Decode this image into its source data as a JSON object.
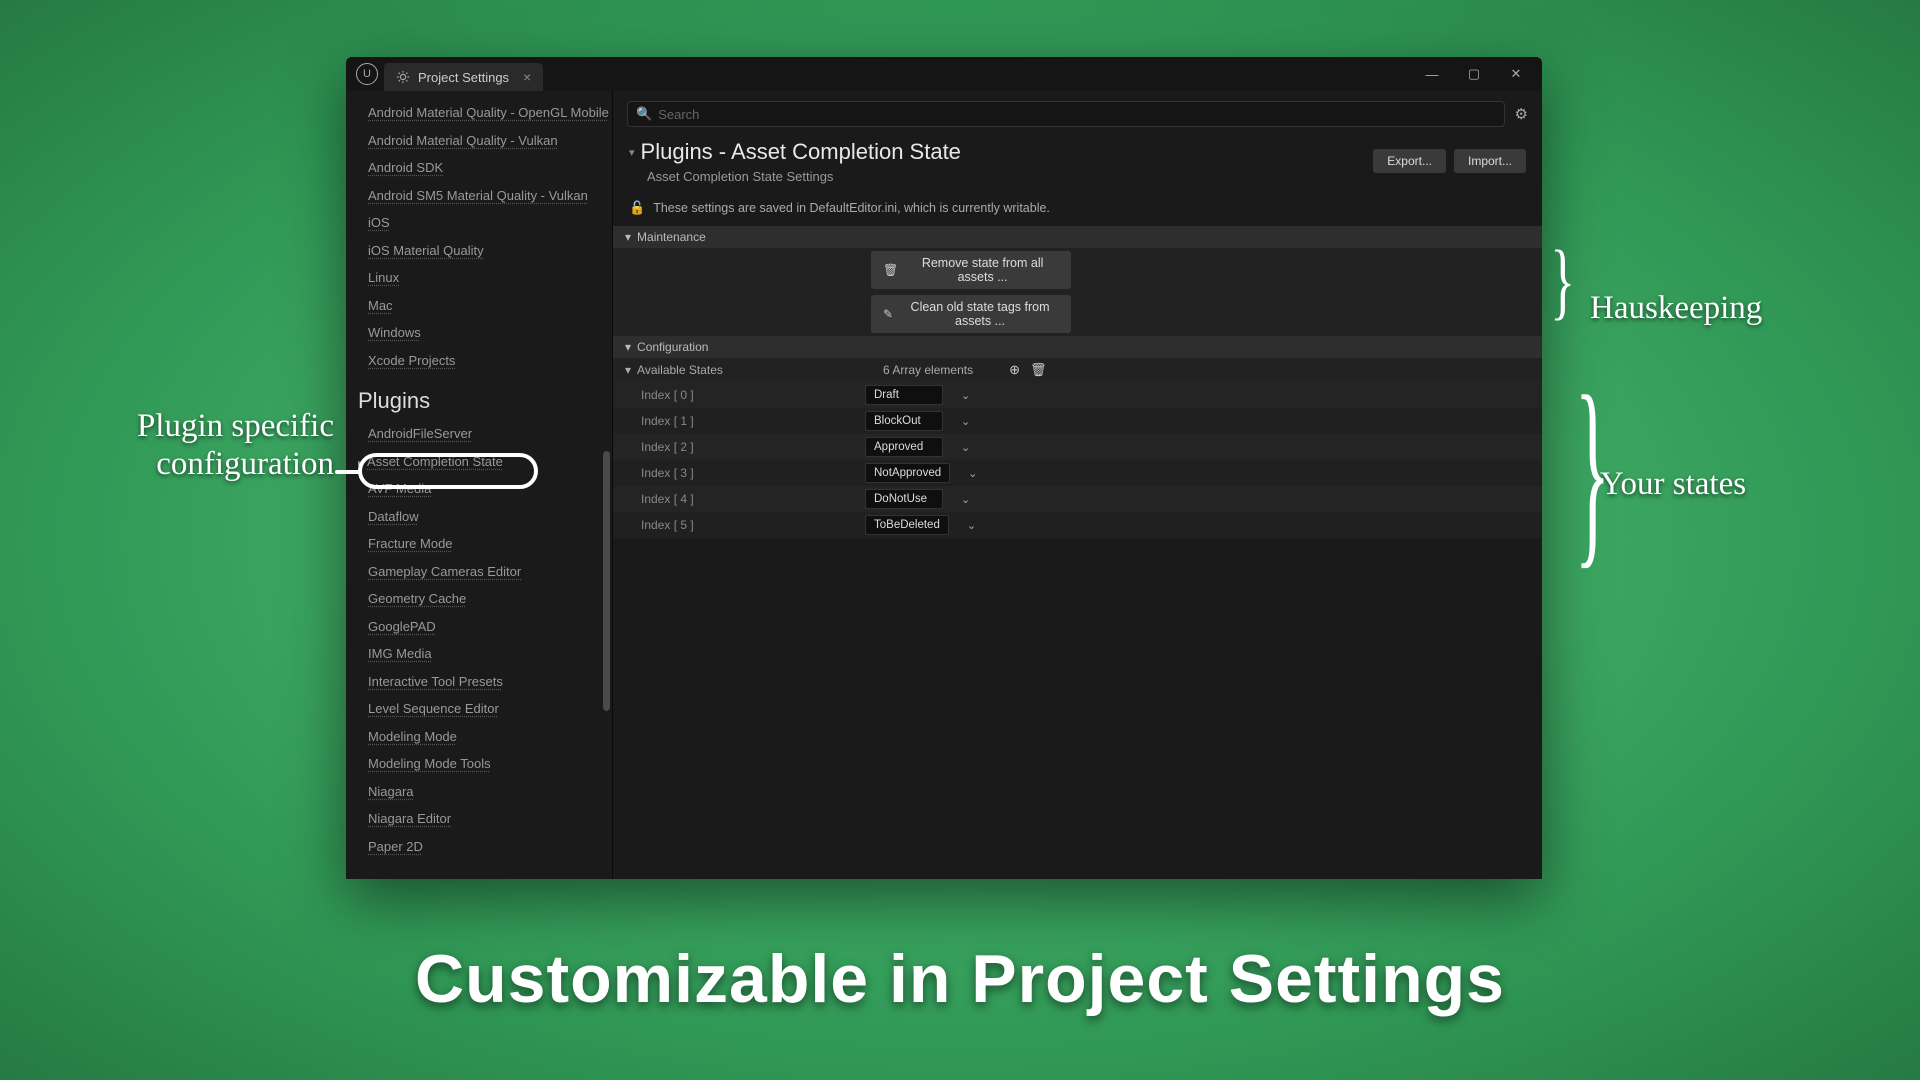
{
  "tab": {
    "title": "Project Settings"
  },
  "sidebar": {
    "platforms": [
      "Android Material Quality - OpenGL Mobile",
      "Android Material Quality - Vulkan",
      "Android SDK",
      "Android SM5 Material Quality - Vulkan",
      "iOS",
      "iOS Material Quality",
      "Linux",
      "Mac",
      "Windows",
      "Xcode Projects"
    ],
    "plugins_heading": "Plugins",
    "plugins": [
      "AndroidFileServer",
      "Asset Completion State",
      "AVF Media",
      "Dataflow",
      "Fracture Mode",
      "Gameplay Cameras Editor",
      "Geometry Cache",
      "GooglePAD",
      "IMG Media",
      "Interactive Tool Presets",
      "Level Sequence Editor",
      "Modeling Mode",
      "Modeling Mode Tools",
      "Niagara",
      "Niagara Editor",
      "Paper 2D"
    ],
    "selected_index": 1
  },
  "search": {
    "placeholder": "Search"
  },
  "header": {
    "title": "Plugins - Asset Completion State",
    "subtitle": "Asset Completion State Settings",
    "export": "Export...",
    "import": "Import..."
  },
  "lock_msg": "These settings are saved in DefaultEditor.ini, which is currently writable.",
  "sections": {
    "maintenance": {
      "title": "Maintenance",
      "btn_remove": "Remove state from all assets ...",
      "btn_clean": "Clean old state tags from assets ..."
    },
    "configuration": {
      "title": "Configuration"
    },
    "available": {
      "title": "Available States",
      "count": "6 Array elements",
      "items": [
        {
          "idx": "Index [ 0 ]",
          "val": "Draft"
        },
        {
          "idx": "Index [ 1 ]",
          "val": "BlockOut"
        },
        {
          "idx": "Index [ 2 ]",
          "val": "Approved"
        },
        {
          "idx": "Index [ 3 ]",
          "val": "NotApproved"
        },
        {
          "idx": "Index [ 4 ]",
          "val": "DoNotUse"
        },
        {
          "idx": "Index [ 5 ]",
          "val": "ToBeDeleted"
        }
      ]
    }
  },
  "annotations": {
    "left": "Plugin specific\nconfiguration",
    "right1": "Hauskeeping",
    "right2": "Your states",
    "caption": "Customizable in Project Settings"
  }
}
